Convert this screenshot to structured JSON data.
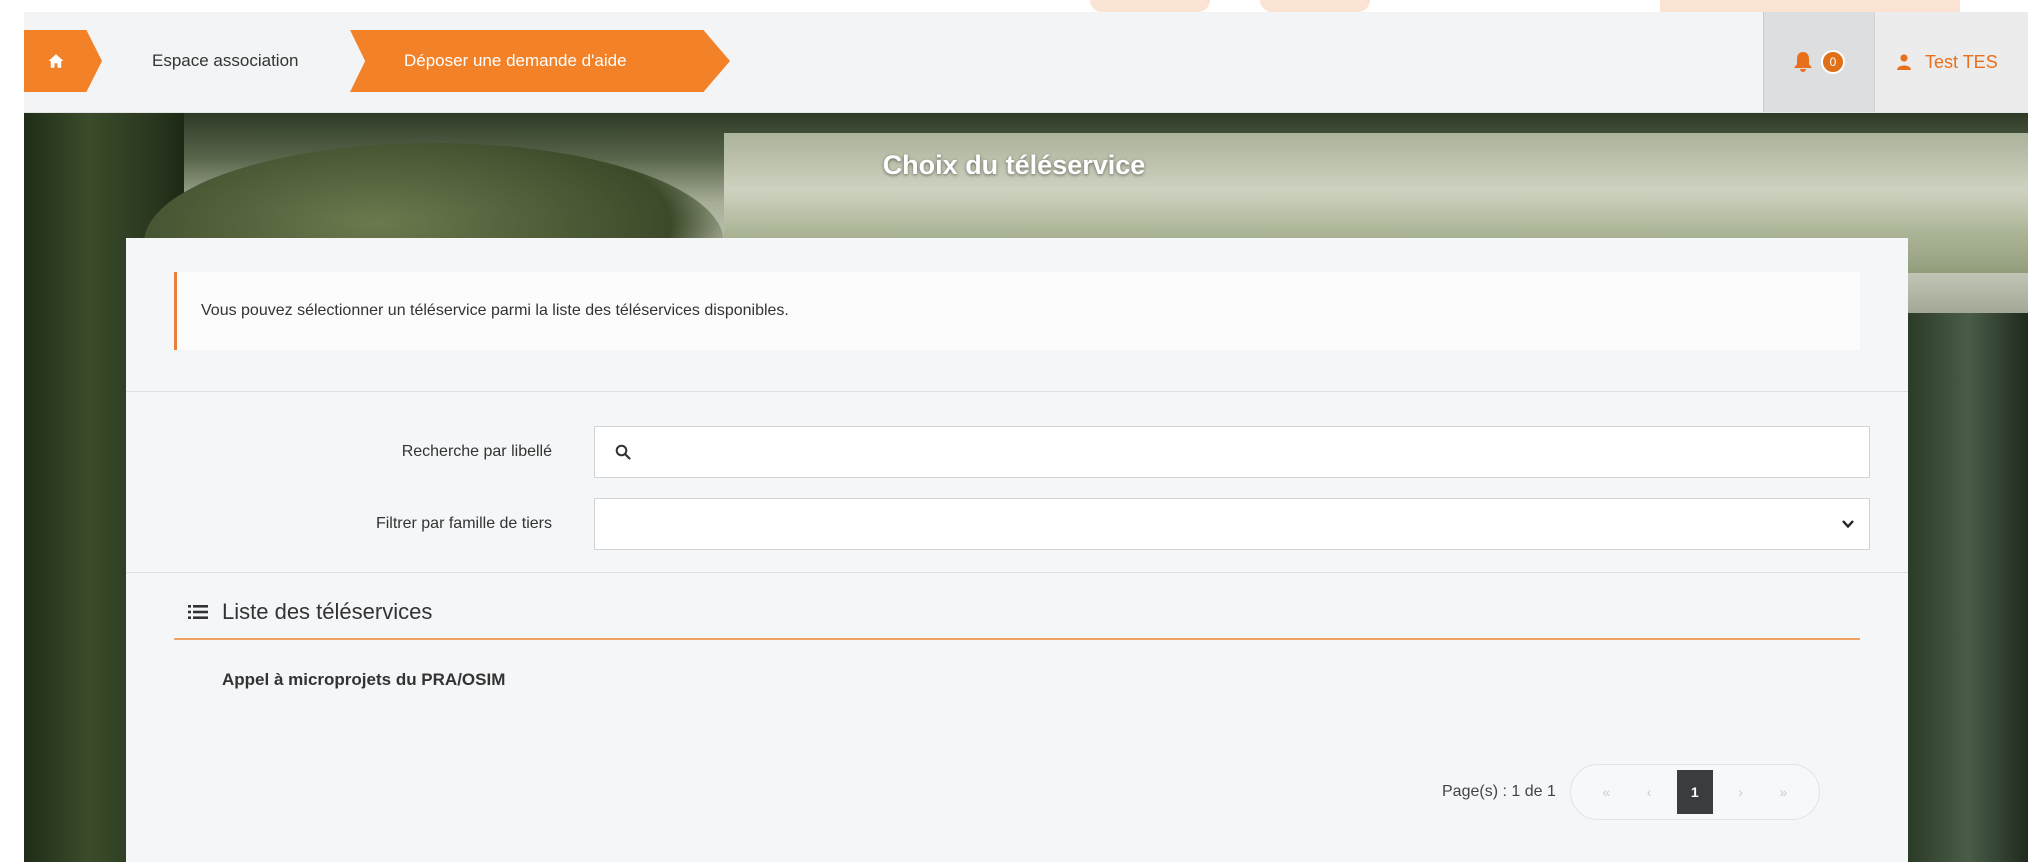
{
  "breadcrumb": {
    "home_icon": "home-icon",
    "item1": "Espace association",
    "item2": "Déposer une demande d'aide"
  },
  "header": {
    "notification_count": "0",
    "user_name": "Test TES"
  },
  "page": {
    "title": "Choix du téléservice"
  },
  "info": {
    "message": "Vous pouvez sélectionner un téléservice parmi la liste des téléservices disponibles."
  },
  "form": {
    "search_label": "Recherche par libellé",
    "search_value": "",
    "filter_label": "Filtrer par famille de tiers",
    "filter_value": ""
  },
  "list": {
    "title": "Liste des téléservices",
    "items": [
      "Appel à microprojets du PRA/OSIM"
    ]
  },
  "pagination": {
    "label": "Page(s) : 1 de 1",
    "first": "«",
    "prev": "‹",
    "current": "1",
    "next": "›",
    "last": "»"
  },
  "colors": {
    "accent": "#f28128",
    "card_bg": "#f4f6f8",
    "active_page": "#3a3d40"
  }
}
